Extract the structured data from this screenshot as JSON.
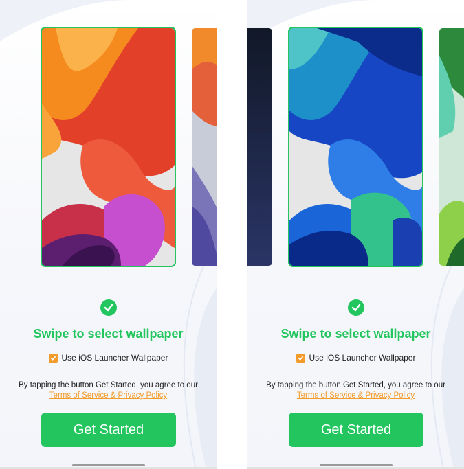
{
  "screens": [
    {
      "checkmark_icon": "check-circle-icon",
      "title": "Swipe to select wallpaper",
      "checkbox_label": "Use iOS Launcher Wallpaper",
      "checkbox_checked": true,
      "agree_text": "By tapping the button Get Started, you agree to our",
      "terms_link": "Terms of Service & Privacy Policy",
      "cta_label": "Get Started",
      "selected_wallpaper": "orange-red"
    },
    {
      "checkmark_icon": "check-circle-icon",
      "title": "Swipe to select wallpaper",
      "checkbox_label": "Use iOS Launcher Wallpaper",
      "checkbox_checked": true,
      "agree_text": "By tapping the button Get Started, you agree to our",
      "terms_link": "Terms of Service & Privacy Policy",
      "cta_label": "Get Started",
      "selected_wallpaper": "blue-teal"
    }
  ],
  "colors": {
    "accent_green": "#22c55e",
    "link_orange": "#f39c2c"
  }
}
